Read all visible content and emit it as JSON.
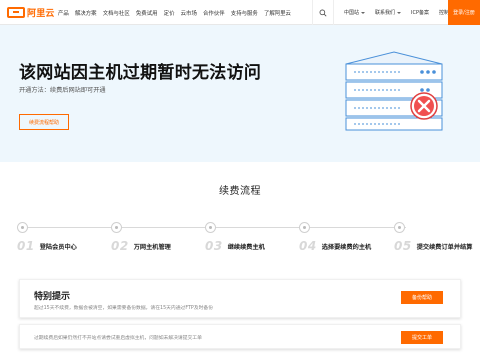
{
  "brand": {
    "logo_text": "阿里云",
    "accent": "#ff6a00"
  },
  "nav": {
    "items": [
      "产品",
      "解决方案",
      "文档与社区",
      "免费试用",
      "定价",
      "云市场",
      "合作伙伴",
      "支持与服务",
      "了解阿里云"
    ],
    "search_icon": "search-icon",
    "right_items": [
      "中国站",
      "联系我们",
      "ICP备案",
      "控制台"
    ],
    "login_label": "登录/注册"
  },
  "hero": {
    "title": "该网站因主机过期暂时无法访问",
    "subtitle": "开通方法：续费后网站即可开通",
    "button_label": "续费流程帮助"
  },
  "process": {
    "title": "续费流程",
    "steps": [
      {
        "num": "01",
        "label": "登陆会员中心"
      },
      {
        "num": "02",
        "label": "万网主机管理"
      },
      {
        "num": "03",
        "label": "继续续费主机"
      },
      {
        "num": "04",
        "label": "选择要续费的主机"
      },
      {
        "num": "05",
        "label": "提交续费订单并结算"
      }
    ]
  },
  "notice1": {
    "title": "特别提示",
    "text": "超过15天不续费，数据会被清空，如果需要备份数据，请在15天内通过FTP及时备份",
    "button_label": "备份帮助"
  },
  "notice2": {
    "text": "过期续费后如果仍然打不开站点请尝试重启虚拟主机，问题如未解决请提交工单",
    "button_label": "提交工单"
  }
}
